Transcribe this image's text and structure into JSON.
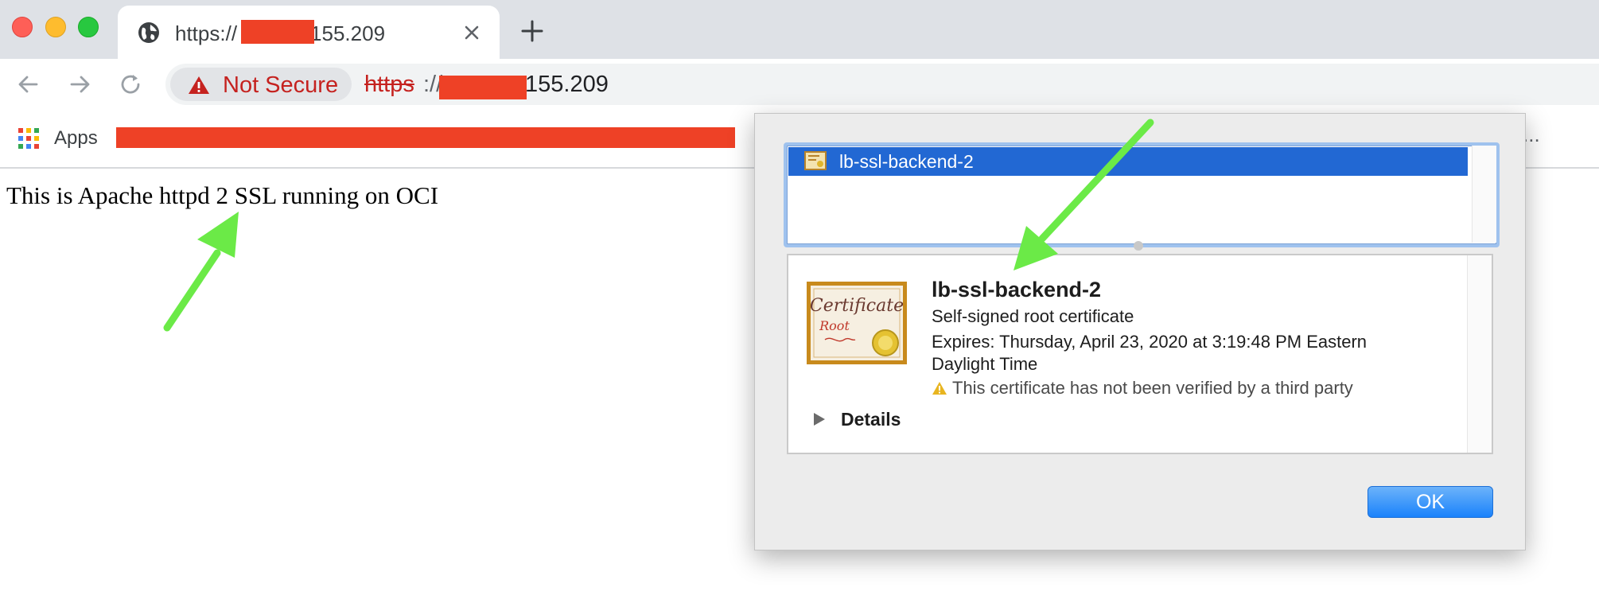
{
  "window": {
    "traffic_lights": [
      "close",
      "minimize",
      "zoom"
    ]
  },
  "tab": {
    "title_prefix": "https://",
    "title_suffix": "155.209",
    "close_icon": "close-icon",
    "new_tab_icon": "plus-icon"
  },
  "toolbar": {
    "back_icon": "arrow-left-icon",
    "forward_icon": "arrow-right-icon",
    "reload_icon": "reload-icon",
    "security_label": "Not Secure",
    "url_scheme": "https",
    "url_separator": "://",
    "url_host_suffix": "155.209"
  },
  "bookmarks": {
    "apps_label": "Apps",
    "overflow": "..."
  },
  "page": {
    "body_text": "This is Apache httpd 2 SSL running on OCI"
  },
  "certificate_dialog": {
    "list_items": [
      {
        "label": "lb-ssl-backend-2",
        "selected": true
      }
    ],
    "name": "lb-ssl-backend-2",
    "kind": "Self-signed root certificate",
    "expires_line1": "Expires: Thursday, April 23, 2020 at 3:19:48 PM Eastern",
    "expires_line2": "Daylight Time",
    "warning": "This certificate has not been verified by a third party",
    "details_label": "Details",
    "ok_label": "OK",
    "image_text": {
      "certificate": "Certificate",
      "root": "Root"
    }
  },
  "colors": {
    "annotation_arrow": "#6bea47",
    "redaction": "#ee4126",
    "selection": "#2268d3",
    "not_secure": "#c5221f"
  }
}
